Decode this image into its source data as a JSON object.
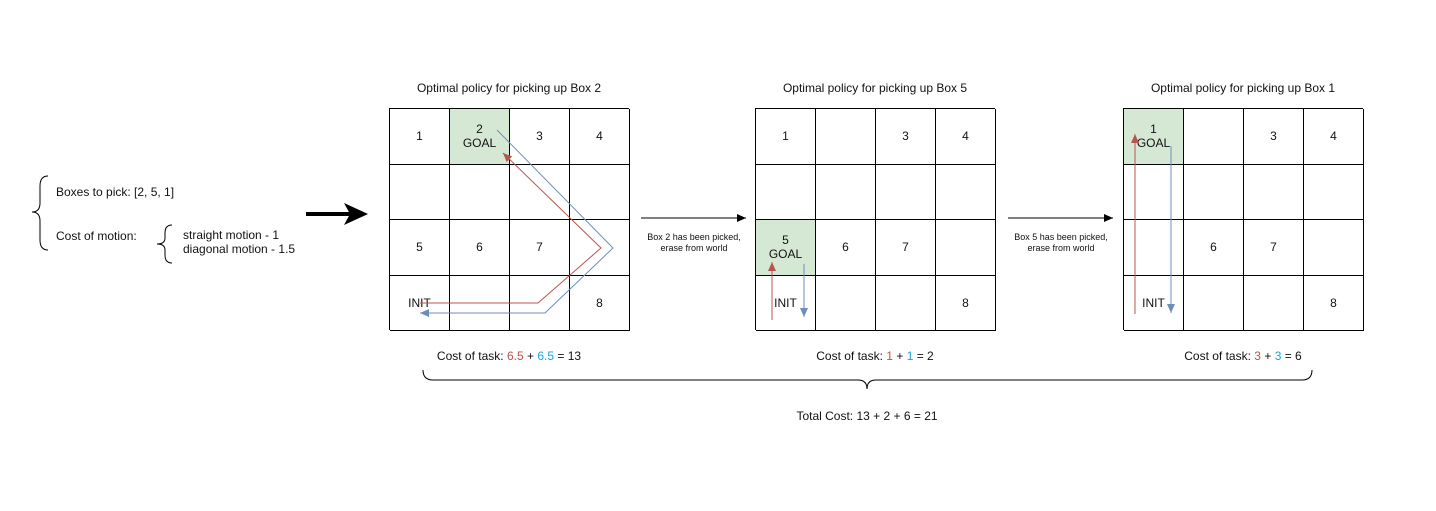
{
  "left_panel": {
    "boxes_label": "Boxes to pick: [2, 5, 1]",
    "cost_label": "Cost of motion:",
    "straight": "straight motion - 1",
    "diagonal": "diagonal motion - 1.5"
  },
  "grids": [
    {
      "title": "Optimal policy for picking up Box 2",
      "cells": [
        "1",
        "2|GOAL",
        "3",
        "4",
        "",
        "",
        "",
        "",
        "5",
        "6",
        "7",
        "",
        "INIT",
        "",
        "",
        "8"
      ],
      "goal_index": 1,
      "cost_prefix": "Cost of task:",
      "cost_red": "6.5",
      "cost_plus": "+",
      "cost_blue": "6.5",
      "cost_result": "= 13"
    },
    {
      "title": "Optimal policy for picking up Box 5",
      "cells": [
        "1",
        "",
        "3",
        "4",
        "",
        "",
        "",
        "",
        "5|GOAL",
        "6",
        "7",
        "",
        "INIT",
        "",
        "",
        "8"
      ],
      "goal_index": 8,
      "cost_prefix": "Cost of task:",
      "cost_red": "1",
      "cost_plus": "+",
      "cost_blue": "1",
      "cost_result": "= 2"
    },
    {
      "title": "Optimal policy for picking up Box 1",
      "cells": [
        "1|GOAL",
        "",
        "3",
        "4",
        "",
        "",
        "",
        "",
        "",
        "6",
        "7",
        "",
        "INIT",
        "",
        "",
        "8"
      ],
      "goal_index": 0,
      "cost_prefix": "Cost of task:",
      "cost_red": "3",
      "cost_plus": "+",
      "cost_blue": "3",
      "cost_result": "= 6"
    }
  ],
  "transitions": [
    {
      "line1": "Box 2 has been picked,",
      "line2": "erase from world"
    },
    {
      "line1": "Box 5 has been picked,",
      "line2": "erase from world"
    }
  ],
  "total": "Total Cost: 13 + 2 + 6 = 21",
  "colors": {
    "red_path": "#b85450",
    "blue_path": "#6c8ebf",
    "goal_fill": "#d5e8d4"
  }
}
